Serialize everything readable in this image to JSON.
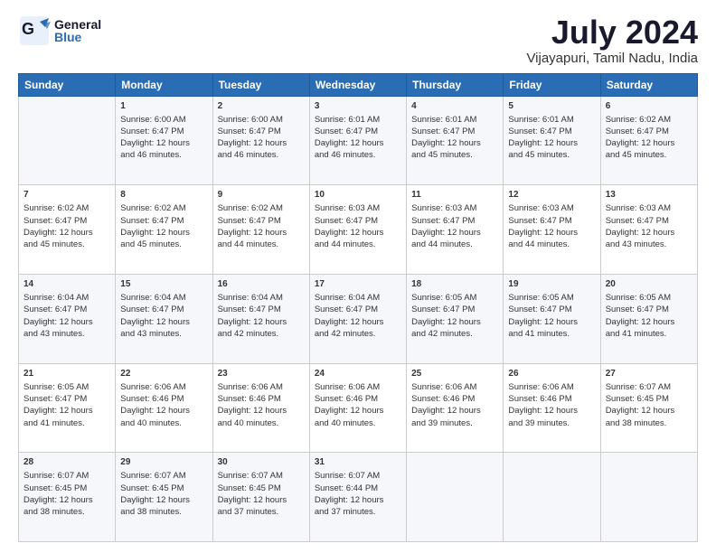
{
  "header": {
    "logo_general": "General",
    "logo_blue": "Blue",
    "title": "July 2024",
    "subtitle": "Vijayapuri, Tamil Nadu, India"
  },
  "columns": [
    "Sunday",
    "Monday",
    "Tuesday",
    "Wednesday",
    "Thursday",
    "Friday",
    "Saturday"
  ],
  "weeks": [
    [
      {
        "day": "",
        "lines": []
      },
      {
        "day": "1",
        "lines": [
          "Sunrise: 6:00 AM",
          "Sunset: 6:47 PM",
          "Daylight: 12 hours",
          "and 46 minutes."
        ]
      },
      {
        "day": "2",
        "lines": [
          "Sunrise: 6:00 AM",
          "Sunset: 6:47 PM",
          "Daylight: 12 hours",
          "and 46 minutes."
        ]
      },
      {
        "day": "3",
        "lines": [
          "Sunrise: 6:01 AM",
          "Sunset: 6:47 PM",
          "Daylight: 12 hours",
          "and 46 minutes."
        ]
      },
      {
        "day": "4",
        "lines": [
          "Sunrise: 6:01 AM",
          "Sunset: 6:47 PM",
          "Daylight: 12 hours",
          "and 45 minutes."
        ]
      },
      {
        "day": "5",
        "lines": [
          "Sunrise: 6:01 AM",
          "Sunset: 6:47 PM",
          "Daylight: 12 hours",
          "and 45 minutes."
        ]
      },
      {
        "day": "6",
        "lines": [
          "Sunrise: 6:02 AM",
          "Sunset: 6:47 PM",
          "Daylight: 12 hours",
          "and 45 minutes."
        ]
      }
    ],
    [
      {
        "day": "7",
        "lines": [
          "Sunrise: 6:02 AM",
          "Sunset: 6:47 PM",
          "Daylight: 12 hours",
          "and 45 minutes."
        ]
      },
      {
        "day": "8",
        "lines": [
          "Sunrise: 6:02 AM",
          "Sunset: 6:47 PM",
          "Daylight: 12 hours",
          "and 45 minutes."
        ]
      },
      {
        "day": "9",
        "lines": [
          "Sunrise: 6:02 AM",
          "Sunset: 6:47 PM",
          "Daylight: 12 hours",
          "and 44 minutes."
        ]
      },
      {
        "day": "10",
        "lines": [
          "Sunrise: 6:03 AM",
          "Sunset: 6:47 PM",
          "Daylight: 12 hours",
          "and 44 minutes."
        ]
      },
      {
        "day": "11",
        "lines": [
          "Sunrise: 6:03 AM",
          "Sunset: 6:47 PM",
          "Daylight: 12 hours",
          "and 44 minutes."
        ]
      },
      {
        "day": "12",
        "lines": [
          "Sunrise: 6:03 AM",
          "Sunset: 6:47 PM",
          "Daylight: 12 hours",
          "and 44 minutes."
        ]
      },
      {
        "day": "13",
        "lines": [
          "Sunrise: 6:03 AM",
          "Sunset: 6:47 PM",
          "Daylight: 12 hours",
          "and 43 minutes."
        ]
      }
    ],
    [
      {
        "day": "14",
        "lines": [
          "Sunrise: 6:04 AM",
          "Sunset: 6:47 PM",
          "Daylight: 12 hours",
          "and 43 minutes."
        ]
      },
      {
        "day": "15",
        "lines": [
          "Sunrise: 6:04 AM",
          "Sunset: 6:47 PM",
          "Daylight: 12 hours",
          "and 43 minutes."
        ]
      },
      {
        "day": "16",
        "lines": [
          "Sunrise: 6:04 AM",
          "Sunset: 6:47 PM",
          "Daylight: 12 hours",
          "and 42 minutes."
        ]
      },
      {
        "day": "17",
        "lines": [
          "Sunrise: 6:04 AM",
          "Sunset: 6:47 PM",
          "Daylight: 12 hours",
          "and 42 minutes."
        ]
      },
      {
        "day": "18",
        "lines": [
          "Sunrise: 6:05 AM",
          "Sunset: 6:47 PM",
          "Daylight: 12 hours",
          "and 42 minutes."
        ]
      },
      {
        "day": "19",
        "lines": [
          "Sunrise: 6:05 AM",
          "Sunset: 6:47 PM",
          "Daylight: 12 hours",
          "and 41 minutes."
        ]
      },
      {
        "day": "20",
        "lines": [
          "Sunrise: 6:05 AM",
          "Sunset: 6:47 PM",
          "Daylight: 12 hours",
          "and 41 minutes."
        ]
      }
    ],
    [
      {
        "day": "21",
        "lines": [
          "Sunrise: 6:05 AM",
          "Sunset: 6:47 PM",
          "Daylight: 12 hours",
          "and 41 minutes."
        ]
      },
      {
        "day": "22",
        "lines": [
          "Sunrise: 6:06 AM",
          "Sunset: 6:46 PM",
          "Daylight: 12 hours",
          "and 40 minutes."
        ]
      },
      {
        "day": "23",
        "lines": [
          "Sunrise: 6:06 AM",
          "Sunset: 6:46 PM",
          "Daylight: 12 hours",
          "and 40 minutes."
        ]
      },
      {
        "day": "24",
        "lines": [
          "Sunrise: 6:06 AM",
          "Sunset: 6:46 PM",
          "Daylight: 12 hours",
          "and 40 minutes."
        ]
      },
      {
        "day": "25",
        "lines": [
          "Sunrise: 6:06 AM",
          "Sunset: 6:46 PM",
          "Daylight: 12 hours",
          "and 39 minutes."
        ]
      },
      {
        "day": "26",
        "lines": [
          "Sunrise: 6:06 AM",
          "Sunset: 6:46 PM",
          "Daylight: 12 hours",
          "and 39 minutes."
        ]
      },
      {
        "day": "27",
        "lines": [
          "Sunrise: 6:07 AM",
          "Sunset: 6:45 PM",
          "Daylight: 12 hours",
          "and 38 minutes."
        ]
      }
    ],
    [
      {
        "day": "28",
        "lines": [
          "Sunrise: 6:07 AM",
          "Sunset: 6:45 PM",
          "Daylight: 12 hours",
          "and 38 minutes."
        ]
      },
      {
        "day": "29",
        "lines": [
          "Sunrise: 6:07 AM",
          "Sunset: 6:45 PM",
          "Daylight: 12 hours",
          "and 38 minutes."
        ]
      },
      {
        "day": "30",
        "lines": [
          "Sunrise: 6:07 AM",
          "Sunset: 6:45 PM",
          "Daylight: 12 hours",
          "and 37 minutes."
        ]
      },
      {
        "day": "31",
        "lines": [
          "Sunrise: 6:07 AM",
          "Sunset: 6:44 PM",
          "Daylight: 12 hours",
          "and 37 minutes."
        ]
      },
      {
        "day": "",
        "lines": []
      },
      {
        "day": "",
        "lines": []
      },
      {
        "day": "",
        "lines": []
      }
    ]
  ]
}
